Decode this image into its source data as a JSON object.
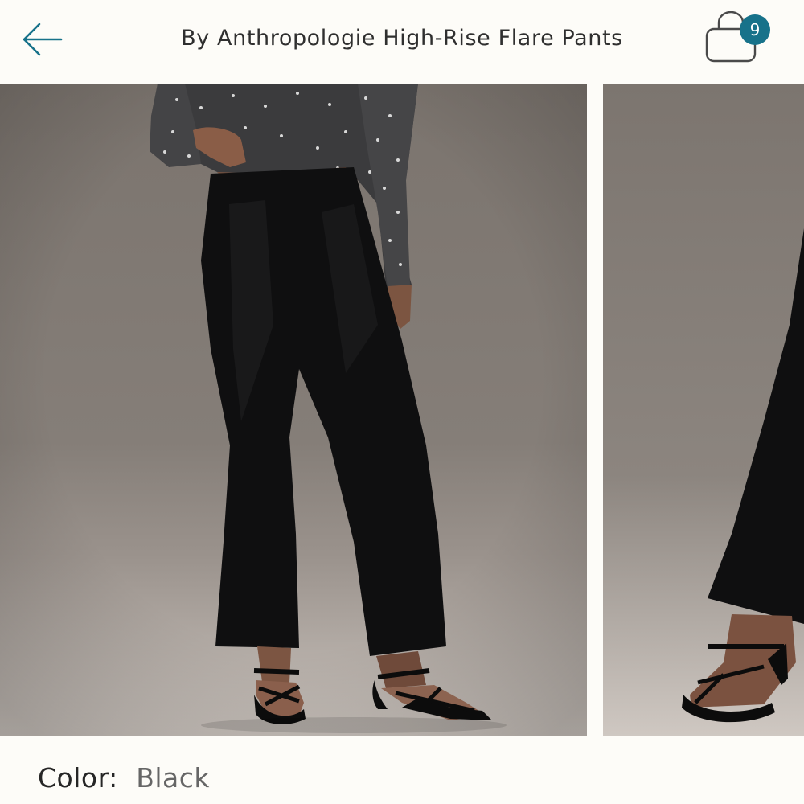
{
  "header": {
    "back_icon": "arrow-left-icon",
    "title": "By Anthropologie High-Rise Flare Pants",
    "bag_icon": "shopping-bag-icon",
    "bag_count": "9"
  },
  "gallery": {
    "images": [
      {
        "name": "model-front-view"
      },
      {
        "name": "model-side-view"
      }
    ]
  },
  "product": {
    "color_label": "Color:",
    "color_value": "Black"
  },
  "colors": {
    "accent": "#17728a",
    "page_background": "#fdfcf8",
    "photo_background": "#7d766f"
  }
}
